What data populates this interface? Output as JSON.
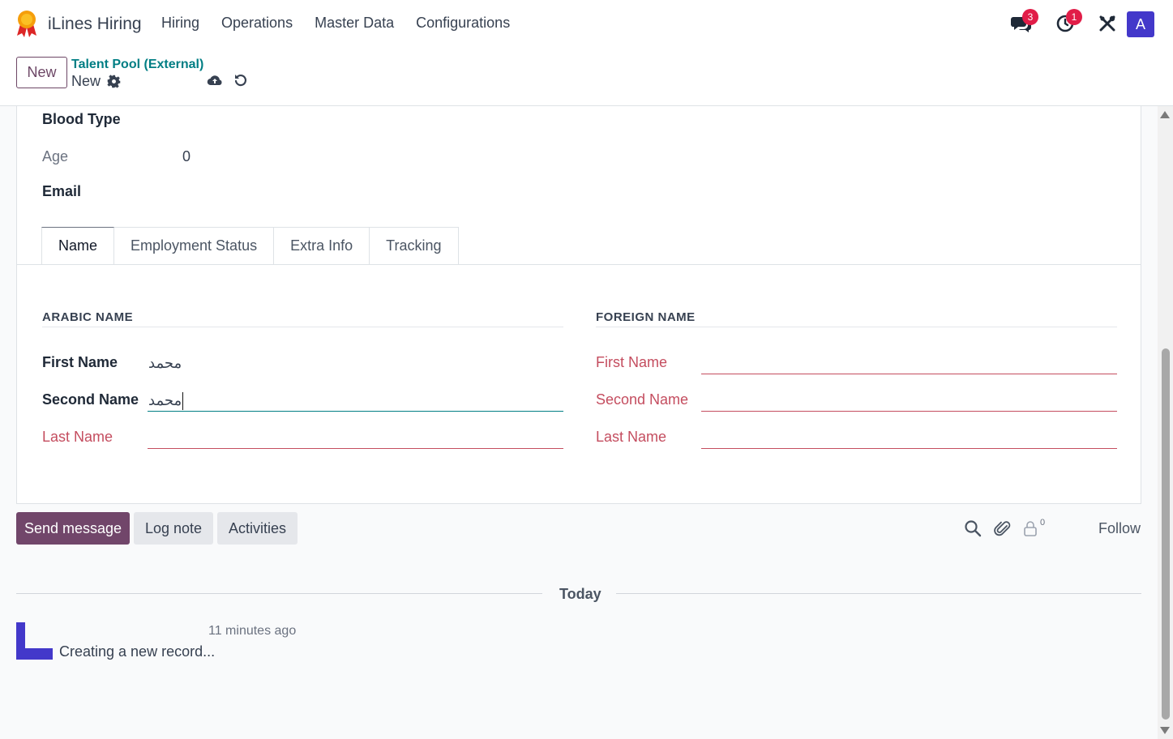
{
  "app": {
    "name": "iLines Hiring"
  },
  "menu": [
    "Hiring",
    "Operations",
    "Master Data",
    "Configurations"
  ],
  "systray": {
    "messages_count": "3",
    "activities_count": "1",
    "avatar_letter": "A"
  },
  "control": {
    "new_label": "New",
    "breadcrumb": "Talent Pool (External)",
    "record_name": "New"
  },
  "form": {
    "blood_type_label": "Blood Type",
    "age_label": "Age",
    "age_value": "0",
    "email_label": "Email",
    "tabs": [
      "Name",
      "Employment Status",
      "Extra Info",
      "Tracking"
    ],
    "arabic": {
      "title": "ARABIC NAME",
      "first_label": "First Name",
      "first_value": "محمد",
      "second_label": "Second Name",
      "second_value": "محمد",
      "last_label": "Last Name",
      "last_value": ""
    },
    "foreign": {
      "title": "FOREIGN NAME",
      "first_label": "First Name",
      "second_label": "Second Name",
      "last_label": "Last Name"
    }
  },
  "chatter": {
    "send_message": "Send message",
    "log_note": "Log note",
    "activities": "Activities",
    "followers_count": "0",
    "follow": "Follow",
    "date_separator": "Today",
    "message_time": "11 minutes ago",
    "message_body": "Creating a new record..."
  }
}
